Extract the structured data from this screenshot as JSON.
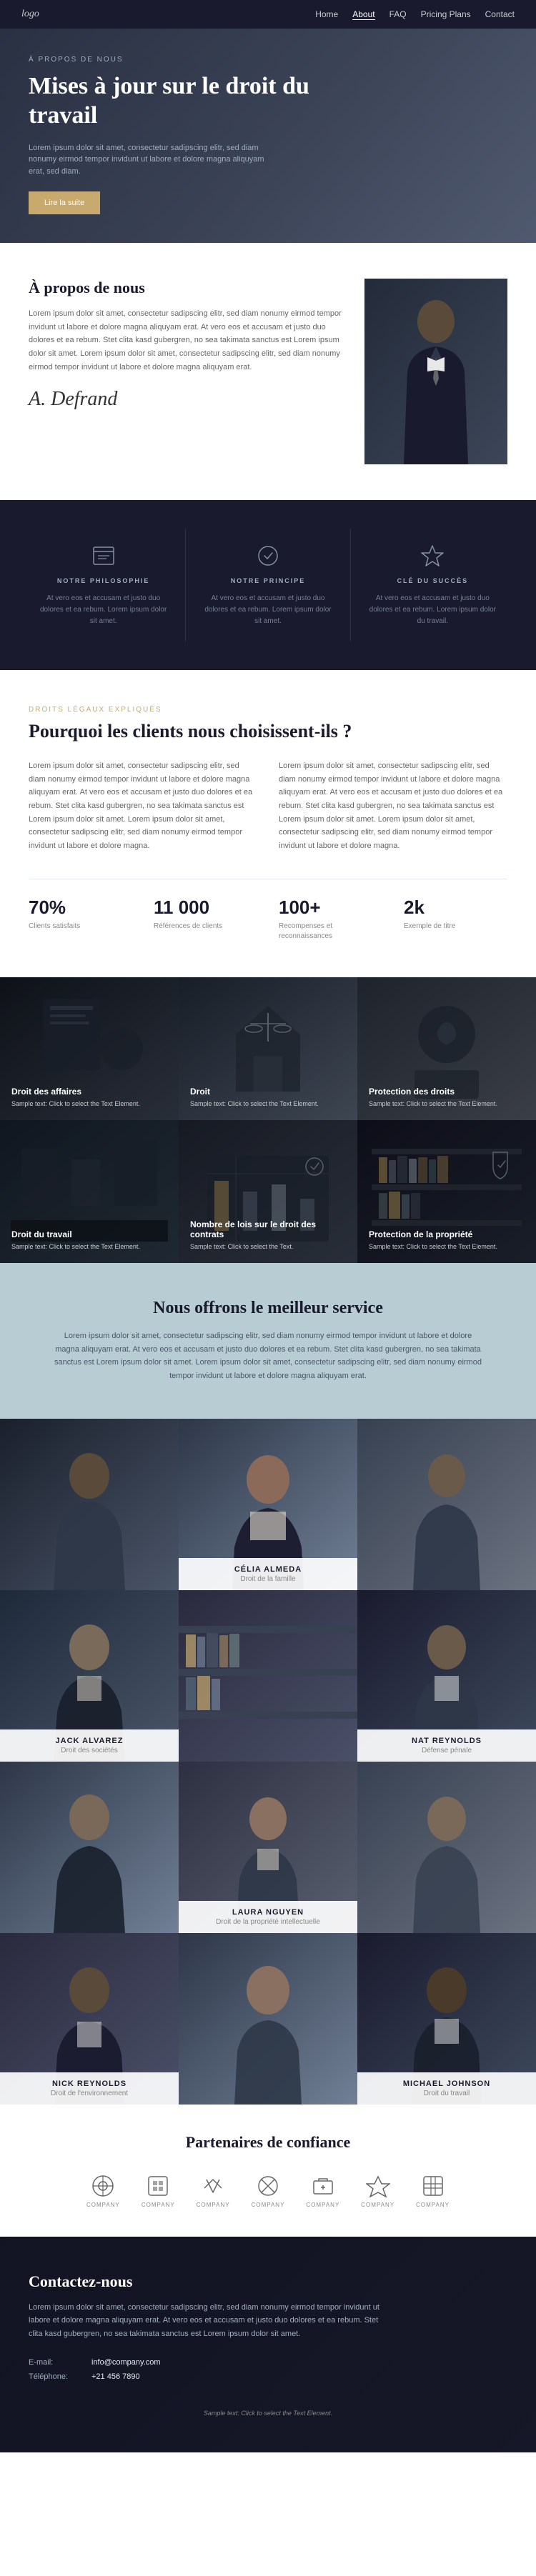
{
  "nav": {
    "logo": "logo",
    "links": [
      "Home",
      "About",
      "FAQ",
      "Pricing Plans",
      "Contact"
    ],
    "active": "About"
  },
  "hero": {
    "label": "À PROPOS DE NOUS",
    "title": "Mises à jour sur le droit du travail",
    "description": "Lorem ipsum dolor sit amet, consectetur sadipscing elitr, sed diam nonumy eirmod tempor invidunt ut labore et dolore magna aliquyam erat, sed diam.",
    "btn": "Lire la suite"
  },
  "about": {
    "heading": "À propos de nous",
    "text": "Lorem ipsum dolor sit amet, consectetur sadipscing elitr, sed diam nonumy eirmod tempor invidunt ut labore et dolore magna aliquyam erat. At vero eos et accusam et justo duo dolores et ea rebum. Stet clita kasd gubergren, no sea takimata sanctus est Lorem ipsum dolor sit amet. Lorem ipsum dolor sit amet, consectetur sadipscing elitr, sed diam nonumy eirmod tempor invidunt ut labore et dolore magna aliquyam erat.",
    "signature": "A. Defrand"
  },
  "philosophy": {
    "columns": [
      {
        "label": "NOTRE PHILOSOPHIE",
        "text": "At vero eos et accusam et justo duo dolores et ea rebum. Lorem ipsum dolor sit amet."
      },
      {
        "label": "NOTRE PRINCIPE",
        "text": "At vero eos et accusam et justo duo dolores et ea rebum. Lorem ipsum dolor sit amet."
      },
      {
        "label": "CLÉ DU SUCCÈS",
        "text": "At vero eos et accusam et justo duo dolores et ea rebum. Lorem ipsum dolor du travail."
      }
    ]
  },
  "why": {
    "label": "DROITS LÉGAUX EXPLIQUÉS",
    "heading": "Pourquoi les clients nous choisissent-ils ?",
    "text1": "Lorem ipsum dolor sit amet, consectetur sadipscing elitr, sed diam nonumy eirmod tempor invidunt ut labore et dolore magna aliquyam erat. At vero eos et accusam et justo duo dolores et ea rebum. Stet clita kasd gubergren, no sea takimata sanctus est Lorem ipsum dolor sit amet. Lorem ipsum dolor sit amet, consectetur sadipscing elitr, sed diam nonumy eirmod tempor invidunt ut labore et dolore magna.",
    "text2": "Lorem ipsum dolor sit amet, consectetur sadipscing elitr, sed diam nonumy eirmod tempor invidunt ut labore et dolore magna aliquyam erat. At vero eos et accusam et justo duo dolores et ea rebum. Stet clita kasd gubergren, no sea takimata sanctus est Lorem ipsum dolor sit amet. Lorem ipsum dolor sit amet, consectetur sadipscing elitr, sed diam nonumy eirmod tempor invidunt ut labore et dolore magna.",
    "stats": [
      {
        "number": "70%",
        "label": "Clients satisfaits"
      },
      {
        "number": "11 000",
        "label": "Références de clients"
      },
      {
        "number": "100+",
        "label": "Recompenses et reconnaissances"
      },
      {
        "number": "2k",
        "label": "Exemple de titre"
      }
    ]
  },
  "services": [
    {
      "title": "Droit des affaires",
      "sample": "Sample text: Click to select the Text Element."
    },
    {
      "title": "Droit",
      "sample": "Sample text: Click to select the Text Element."
    },
    {
      "title": "Protection des droits",
      "sample": "Sample text: Click to select the Text Element."
    },
    {
      "title": "Droit du travail",
      "sample": "Sample text: Click to select the Text Element."
    },
    {
      "title": "Nombre de lois sur le droit des contrats",
      "sample": "Sample text: Click to select the Text."
    },
    {
      "title": "Protection de la propriété",
      "sample": "Sample text: Click to select the Text Element."
    }
  ],
  "bestService": {
    "heading": "Nous offrons le meilleur service",
    "text": "Lorem ipsum dolor sit amet, consectetur sadipscing elitr, sed diam nonumy eirmod tempor invidunt ut labore et dolore magna aliquyam erat. At vero eos et accusam et justo duo dolores et ea rebum. Stet clita kasd gubergren, no sea takimata sanctus est Lorem ipsum dolor sit amet. Lorem ipsum dolor sit amet, consectetur sadipscing elitr, sed diam nonumy eirmod tempor invidunt ut labore et dolore magna aliquyam erat."
  },
  "team": [
    {
      "name": "CÉLIA ALMEDA",
      "role": "Droit de la famille",
      "bg": "team-bg-1"
    },
    {
      "name": "JACK ALVAREZ",
      "role": "Droit des sociétés",
      "bg": "team-bg-2"
    },
    {
      "name": "NAT REYNOLDS",
      "role": "Défense pénale",
      "bg": "team-bg-3"
    },
    {
      "name": "LAURA NGUYEN",
      "role": "Droit de la propriété intellectuelle",
      "bg": "team-bg-4"
    },
    {
      "name": "NICK REYNOLDS",
      "role": "Droit de l'environnement",
      "bg": "team-bg-5"
    },
    {
      "name": "MICHAEL JOHNSON",
      "role": "Droit du travail",
      "bg": "team-bg-6"
    }
  ],
  "partners": {
    "heading": "Partenaires de confiance",
    "logos": [
      {
        "name": "COMPANY",
        "icon": "⊕"
      },
      {
        "name": "COMPANY",
        "icon": "⊞"
      },
      {
        "name": "COMPANY",
        "icon": "⋈"
      },
      {
        "name": "COMPANY",
        "icon": "⊗"
      },
      {
        "name": "COMPANY",
        "icon": "⊡"
      },
      {
        "name": "COMPANY",
        "icon": "⚡"
      },
      {
        "name": "COMPANY",
        "icon": "⊞"
      }
    ]
  },
  "contact": {
    "heading": "Contactez-nous",
    "description": "Lorem ipsum dolor sit amet, consectetur sadipscing elitr, sed diam nonumy eirmod tempor invidunt ut labore et dolore magna aliquyam erat. At vero eos et accusam et justo duo dolores et ea rebum. Stet clita kasd gubergren, no sea takimata sanctus est Lorem ipsum dolor sit amet.",
    "email_label": "E-mail:",
    "email": "info@company.com",
    "phone_label": "Téléphone:",
    "phone": "+21 456 7890"
  },
  "footer": {
    "sample": "Sample text: Click to select the Text Element."
  }
}
